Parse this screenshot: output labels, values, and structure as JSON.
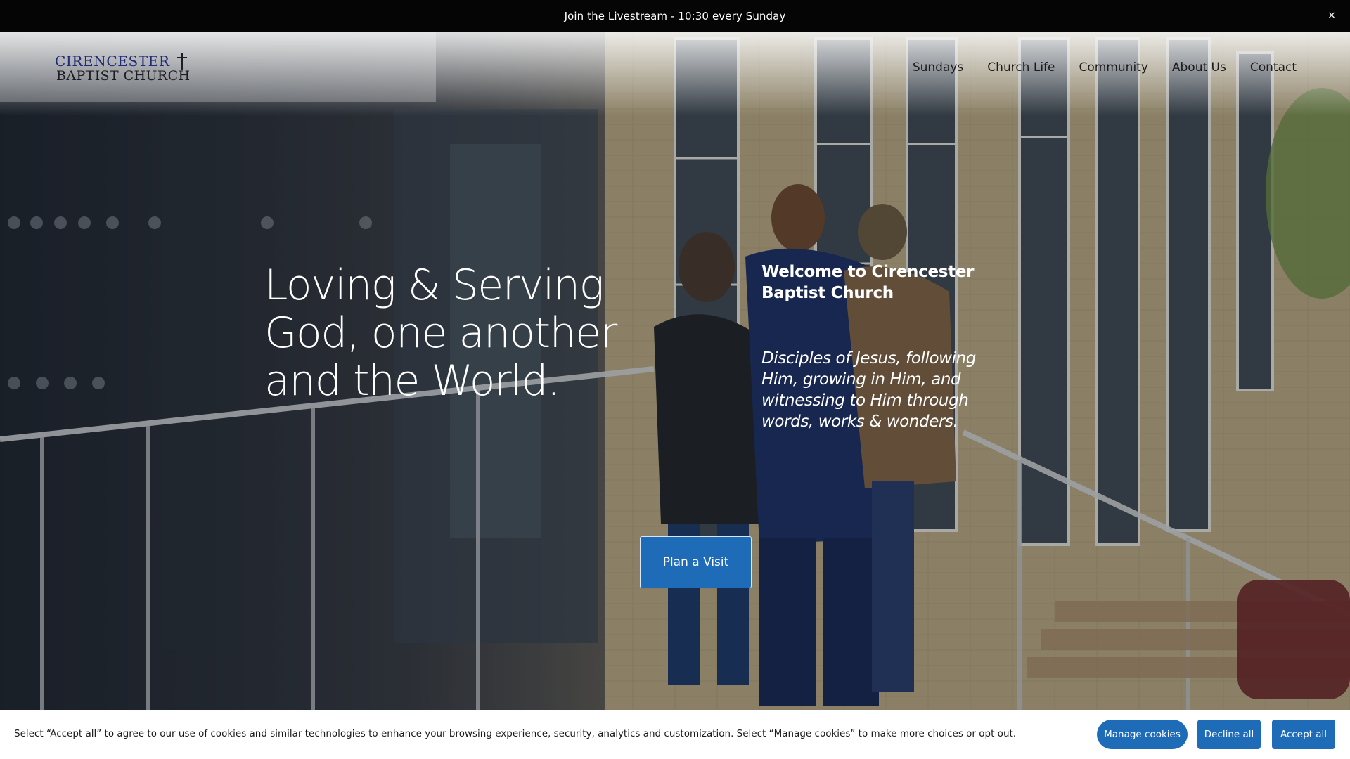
{
  "announcement": {
    "text": "Join the Livestream - 10:30 every Sunday",
    "close_icon": "×"
  },
  "header": {
    "logo": {
      "line1": "CIRENCESTER",
      "line2": "BAPTIST CHURCH",
      "icon": "cross-icon"
    },
    "nav": [
      {
        "label": "Sundays"
      },
      {
        "label": "Church Life"
      },
      {
        "label": "Community"
      },
      {
        "label": "About Us"
      },
      {
        "label": "Contact"
      }
    ]
  },
  "hero": {
    "headline": "Loving & Serving God, one another and the World.",
    "welcome": "Welcome to Cirencester Baptist Church",
    "mission": "Disciples of Jesus, following Him, growing in Him, and witnessing to Him through words, works & wonders.",
    "cta_label": "Plan a Visit"
  },
  "cookie_banner": {
    "text": "Select “Accept all” to agree to our use of cookies and similar technologies to enhance your browsing experience, security, analytics and customization. Select “Manage cookies” to make more choices or opt out.",
    "manage_label": "Manage cookies",
    "decline_label": "Decline all",
    "accept_label": "Accept all"
  },
  "colors": {
    "accent": "#1e6bb8",
    "announcement_bg": "#050505",
    "logo_blue": "#1f2a78"
  }
}
